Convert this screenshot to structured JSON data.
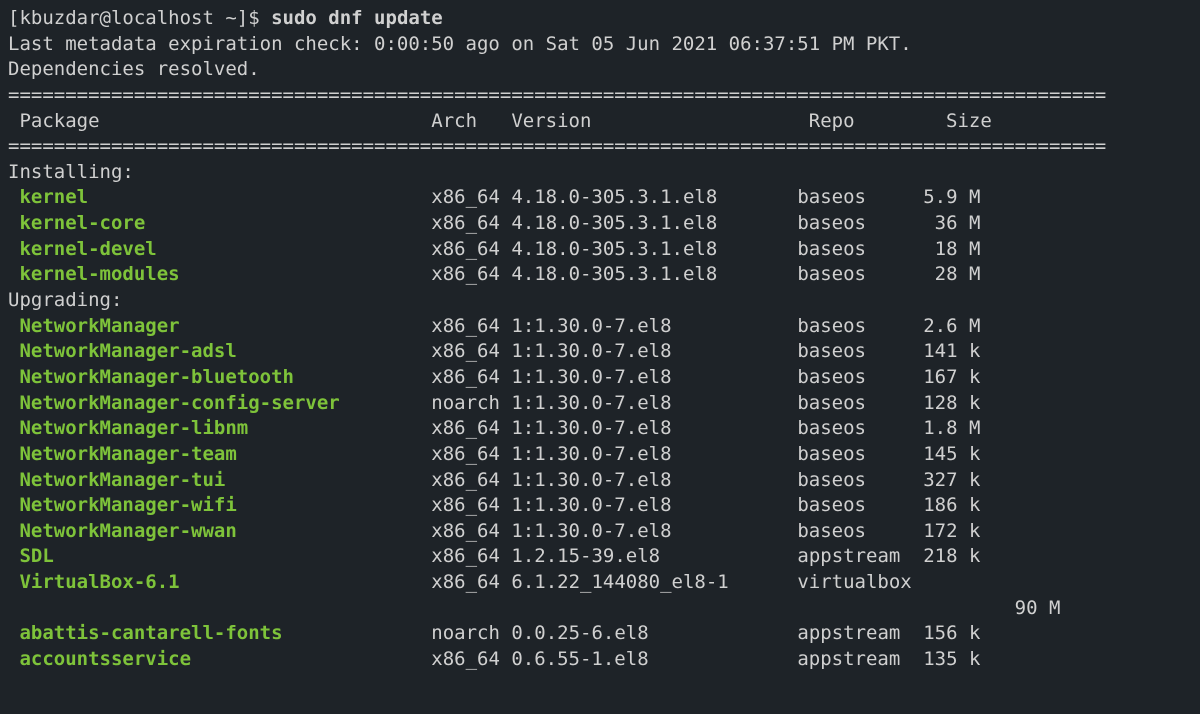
{
  "prompt": "[kbuzdar@localhost ~]$ ",
  "command": "sudo dnf update",
  "meta_line": "Last metadata expiration check: 0:00:50 ago on Sat 05 Jun 2021 06:37:51 PM PKT.",
  "deps_line": "Dependencies resolved.",
  "separator": "================================================================================================",
  "header": {
    "package": " Package",
    "arch": "Arch",
    "version": "Version",
    "repo": "Repo",
    "size": "Size"
  },
  "section_installing": "Installing:",
  "section_upgrading": "Upgrading:",
  "installing": [
    {
      "name": "kernel",
      "arch": "x86_64",
      "version": "4.18.0-305.3.1.el8",
      "repo": "baseos",
      "size": "5.9 M"
    },
    {
      "name": "kernel-core",
      "arch": "x86_64",
      "version": "4.18.0-305.3.1.el8",
      "repo": "baseos",
      "size": " 36 M"
    },
    {
      "name": "kernel-devel",
      "arch": "x86_64",
      "version": "4.18.0-305.3.1.el8",
      "repo": "baseos",
      "size": " 18 M"
    },
    {
      "name": "kernel-modules",
      "arch": "x86_64",
      "version": "4.18.0-305.3.1.el8",
      "repo": "baseos",
      "size": " 28 M"
    }
  ],
  "upgrading": [
    {
      "name": "NetworkManager",
      "arch": "x86_64",
      "version": "1:1.30.0-7.el8",
      "repo": "baseos",
      "size": "2.6 M"
    },
    {
      "name": "NetworkManager-adsl",
      "arch": "x86_64",
      "version": "1:1.30.0-7.el8",
      "repo": "baseos",
      "size": "141 k"
    },
    {
      "name": "NetworkManager-bluetooth",
      "arch": "x86_64",
      "version": "1:1.30.0-7.el8",
      "repo": "baseos",
      "size": "167 k"
    },
    {
      "name": "NetworkManager-config-server",
      "arch": "noarch",
      "version": "1:1.30.0-7.el8",
      "repo": "baseos",
      "size": "128 k"
    },
    {
      "name": "NetworkManager-libnm",
      "arch": "x86_64",
      "version": "1:1.30.0-7.el8",
      "repo": "baseos",
      "size": "1.8 M"
    },
    {
      "name": "NetworkManager-team",
      "arch": "x86_64",
      "version": "1:1.30.0-7.el8",
      "repo": "baseos",
      "size": "145 k"
    },
    {
      "name": "NetworkManager-tui",
      "arch": "x86_64",
      "version": "1:1.30.0-7.el8",
      "repo": "baseos",
      "size": "327 k"
    },
    {
      "name": "NetworkManager-wifi",
      "arch": "x86_64",
      "version": "1:1.30.0-7.el8",
      "repo": "baseos",
      "size": "186 k"
    },
    {
      "name": "NetworkManager-wwan",
      "arch": "x86_64",
      "version": "1:1.30.0-7.el8",
      "repo": "baseos",
      "size": "172 k"
    },
    {
      "name": "SDL",
      "arch": "x86_64",
      "version": "1.2.15-39.el8",
      "repo": "appstream",
      "size": "218 k"
    },
    {
      "name": "VirtualBox-6.1",
      "arch": "x86_64",
      "version": "6.1.22_144080_el8-1",
      "repo": "virtualbox",
      "size": "",
      "size2": " 90 M"
    },
    {
      "name": "abattis-cantarell-fonts",
      "arch": "noarch",
      "version": "0.0.25-6.el8",
      "repo": "appstream",
      "size": "156 k"
    },
    {
      "name": "accountsservice",
      "arch": "x86_64",
      "version": "0.6.55-1.el8",
      "repo": "appstream",
      "size": "135 k"
    }
  ]
}
